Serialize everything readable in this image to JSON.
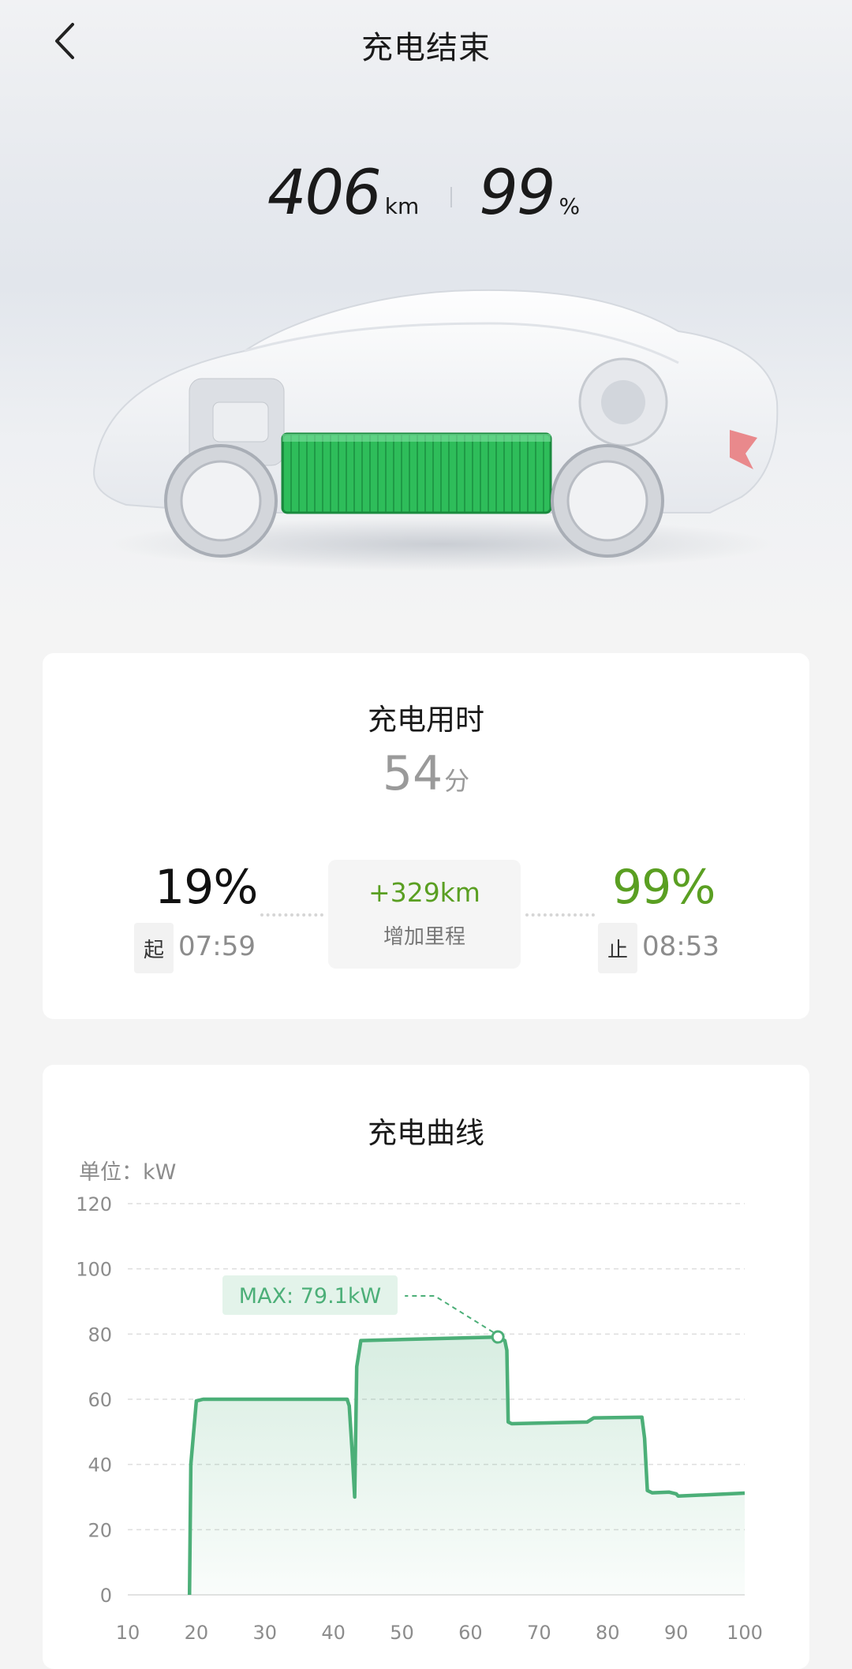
{
  "header": {
    "title": "充电结束"
  },
  "summary": {
    "range_value": "406",
    "range_unit": "km",
    "soc_value": "99",
    "soc_unit": "%"
  },
  "charge_time": {
    "title": "充电用时",
    "duration_value": "54",
    "duration_unit": "分",
    "start_percent": "19%",
    "start_tag": "起",
    "start_time": "07:59",
    "end_percent": "99%",
    "end_tag": "止",
    "end_time": "08:53",
    "added_range": "+329km",
    "added_range_label": "增加里程"
  },
  "curve": {
    "title": "充电曲线",
    "unit_label": "单位：kW",
    "max_label": "MAX: 79.1kW"
  },
  "colors": {
    "accent_green": "#5a9f22",
    "curve_green": "#4caf78",
    "battery_green": "#2ebd5a"
  },
  "chart_data": {
    "type": "area",
    "ylabel": "单位：kW",
    "ylim": [
      0,
      120
    ],
    "xlim": [
      10,
      100
    ],
    "yticks": [
      0,
      20,
      40,
      60,
      80,
      100,
      120
    ],
    "xticks": [
      10,
      20,
      30,
      40,
      50,
      60,
      70,
      80,
      90,
      100
    ],
    "grid": true,
    "annotation": {
      "text": "MAX: 79.1kW",
      "x": 64,
      "y": 79.1
    },
    "series": [
      {
        "x": [
          19,
          19.2,
          20,
          21,
          42,
          42.3,
          42.7,
          43.1,
          43.4,
          44,
          64,
          65,
          65.3,
          65.5,
          66,
          77,
          78,
          85,
          85.4,
          85.8,
          86.5,
          89,
          90,
          90.3,
          100
        ],
        "y": [
          0,
          40,
          59.5,
          60,
          60,
          58,
          45,
          30,
          70,
          78,
          79.1,
          78,
          75,
          53,
          52.5,
          53,
          54.3,
          54.5,
          48,
          32,
          31.3,
          31.5,
          31,
          30.3,
          31.2
        ]
      }
    ]
  }
}
